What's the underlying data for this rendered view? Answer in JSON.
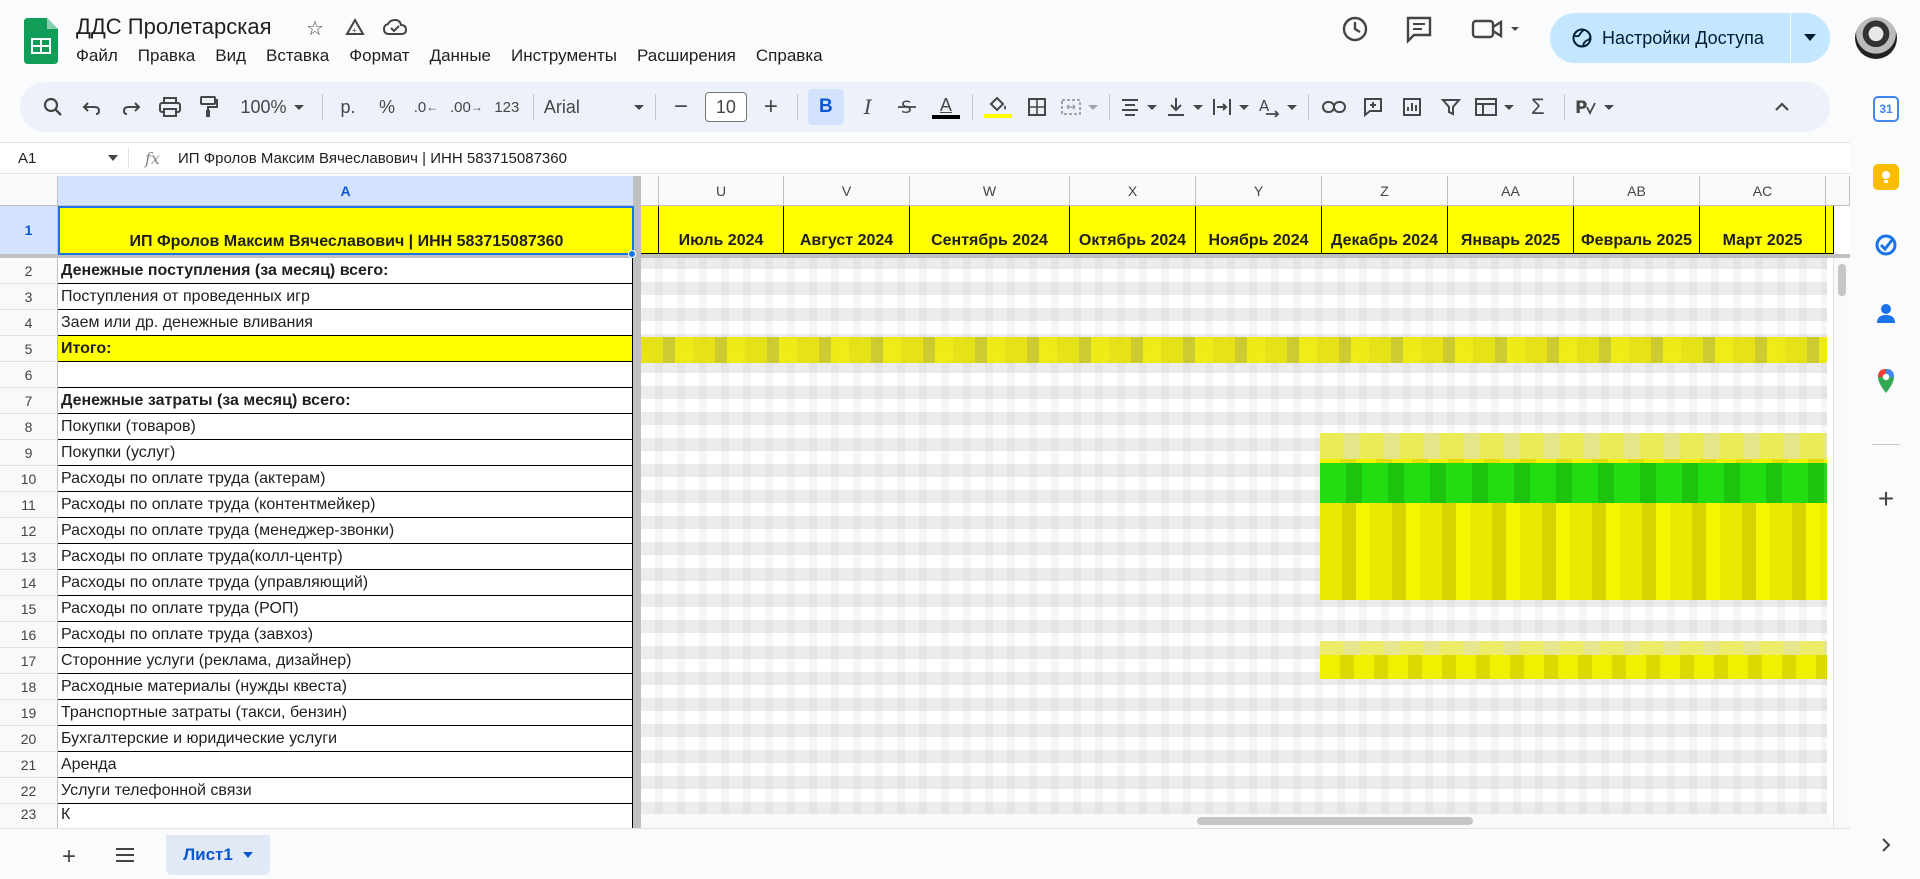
{
  "app": {
    "doc_title": "ДДС Пролетарская",
    "menus": [
      "Файл",
      "Правка",
      "Вид",
      "Вставка",
      "Формат",
      "Данные",
      "Инструменты",
      "Расширения",
      "Справка"
    ],
    "share_label": "Настройки Доступа"
  },
  "toolbar": {
    "zoom": "100%",
    "currency": "р.",
    "percent": "%",
    "dec_decrease": ".0",
    "dec_increase": ".00",
    "number_format": "123",
    "font": "Arial",
    "font_size": "10",
    "bold": "B",
    "italic": "I",
    "text_color_letter": "A"
  },
  "formula_bar": {
    "cell_ref": "A1",
    "fx": "fx",
    "content": "ИП Фролов Максим Вячеславович | ИНН 583715087360"
  },
  "grid": {
    "frozen_column_header": "A",
    "column_headers": [
      "U",
      "V",
      "W",
      "X",
      "Y",
      "Z",
      "AA",
      "AB",
      "AC"
    ],
    "month_headers": [
      "Июль 2024",
      "Август 2024",
      "Сентябрь 2024",
      "Октябрь 2024",
      "Ноябрь 2024",
      "Декабрь 2024",
      "Январь 2025",
      "Февраль 2025",
      "Март 2025"
    ],
    "title_cell": "ИП Фролов Максим Вячеславович | ИНН 583715087360",
    "rows": [
      {
        "num": "1",
        "label": ""
      },
      {
        "num": "2",
        "label": "Денежные поступления (за месяц) всего:"
      },
      {
        "num": "3",
        "label": "Поступления  от проведенных игр"
      },
      {
        "num": "4",
        "label": "Заем или др. денежные вливания"
      },
      {
        "num": "5",
        "label": "Итого:"
      },
      {
        "num": "6",
        "label": ""
      },
      {
        "num": "7",
        "label": "Денежные затраты (за месяц) всего:"
      },
      {
        "num": "8",
        "label": "Покупки (товаров)"
      },
      {
        "num": "9",
        "label": "Покупки (услуг)"
      },
      {
        "num": "10",
        "label": "Расходы по оплате труда (актерам)"
      },
      {
        "num": "11",
        "label": "Расходы по оплате труда (контентмейкер)"
      },
      {
        "num": "12",
        "label": "Расходы по оплате труда (менеджер-звонки)"
      },
      {
        "num": "13",
        "label": "Расходы по оплате труда(колл-центр)"
      },
      {
        "num": "14",
        "label": "Расходы по оплате труда (управляющий)"
      },
      {
        "num": "15",
        "label": "Расходы по оплате труда (РОП)"
      },
      {
        "num": "16",
        "label": "Расходы по оплате труда (завхоз)"
      },
      {
        "num": "17",
        "label": "Сторонние услуги (реклама, дизайнер)"
      },
      {
        "num": "18",
        "label": "Расходные материалы (нужды квеста)"
      },
      {
        "num": "19",
        "label": "Транспортные затраты (такси, бензин)"
      },
      {
        "num": "20",
        "label": "Бухгалтерские и юридические услуги"
      },
      {
        "num": "21",
        "label": "Аренда"
      },
      {
        "num": "22",
        "label": "Услуги телефонной связи"
      },
      {
        "num": "23",
        "label": "К"
      }
    ]
  },
  "sheets": {
    "active": "Лист1"
  },
  "colors": {
    "header_yellow": "#ffff00",
    "highlight_green": "#22dd11",
    "selection_blue": "#1a73e8",
    "share_bg": "#c2e7ff"
  }
}
